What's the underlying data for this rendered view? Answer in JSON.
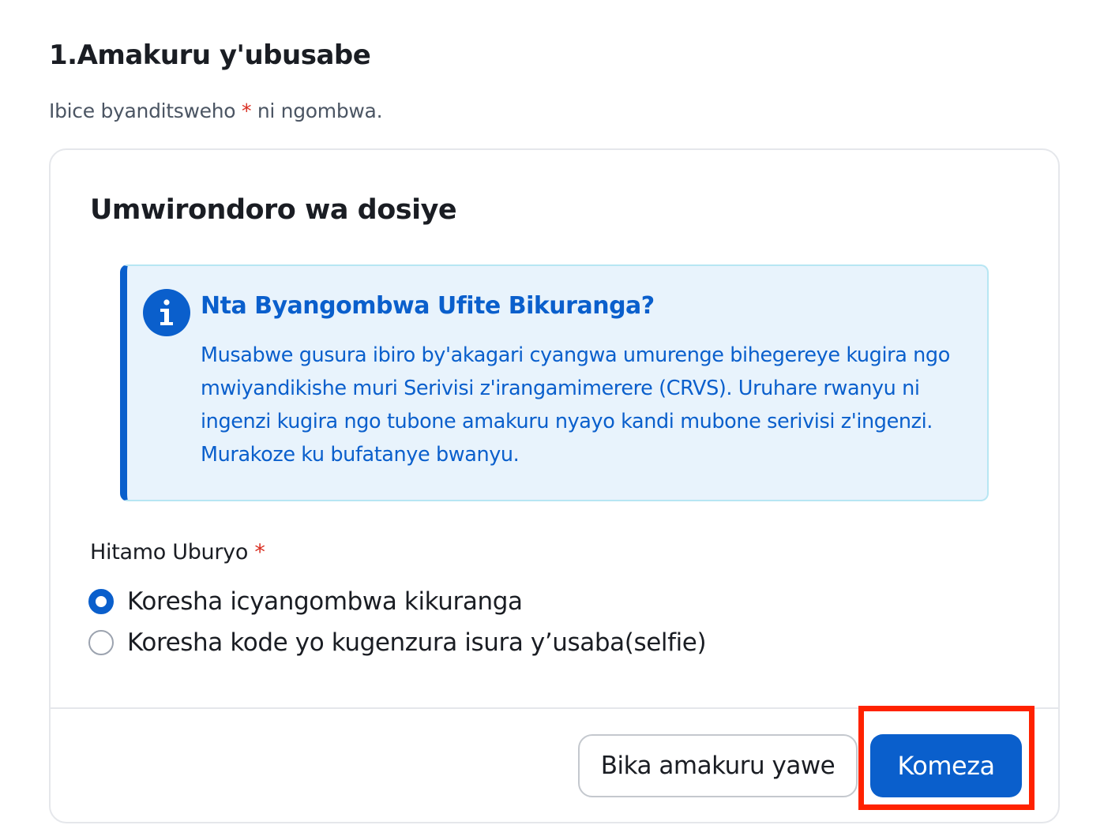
{
  "step": {
    "title": "1.Amakuru y'ubusabe"
  },
  "required_note": {
    "before": "Ibice byanditsweho",
    "asterisk": "*",
    "after": "ni ngombwa."
  },
  "card": {
    "title": "Umwirondoro wa dosiye",
    "info": {
      "icon": "info-icon",
      "title": "Nta Byangombwa Ufite Bikuranga?",
      "text": "Musabwe gusura ibiro by'akagari cyangwa umurenge bihegereye kugira ngo mwiyandikishe muri Serivisi z'irangamimerere (CRVS). Uruhare rwanyu ni ingenzi kugira ngo tubone amakuru nyayo kandi mubone serivisi z'ingenzi. Murakoze ku bufatanye bwanyu."
    },
    "radio_group": {
      "label": "Hitamo Uburyo",
      "asterisk": "*",
      "options": [
        {
          "label": "Koresha icyangombwa kikuranga",
          "selected": true
        },
        {
          "label": "Koresha kode yo kugenzura isura y’usaba(selfie)",
          "selected": false
        }
      ]
    },
    "footer": {
      "save_label": "Bika amakuru yawe",
      "continue_label": "Komeza"
    }
  },
  "colors": {
    "primary": "#0a5fcc",
    "info_bg": "#e8f3fc",
    "required": "#d92d20",
    "highlight": "#ff2200"
  }
}
